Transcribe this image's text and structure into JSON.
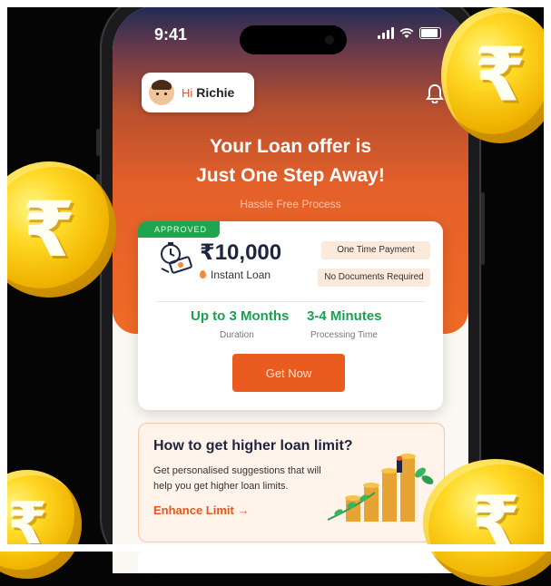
{
  "status_bar": {
    "time": "9:41"
  },
  "greeting": {
    "hi": "Hi",
    "name": "Richie"
  },
  "hero": {
    "title_line1": "Your Loan offer is",
    "title_line2": "Just One Step Away!",
    "subtitle": "Hassle Free Process"
  },
  "offer_card": {
    "badge": "APPROVED",
    "amount": "₹10,000",
    "amount_label": "Instant Loan",
    "chip1": "One Time Payment",
    "chip2": "No Documents Required",
    "duration_value": "Up to 3 Months",
    "duration_label": "Duration",
    "processing_value": "3-4 Minutes",
    "processing_label": "Processing Time",
    "cta": "Get Now"
  },
  "promo": {
    "title": "How to get higher loan limit?",
    "description": "Get personalised suggestions that will help you get higher loan limits.",
    "link": "Enhance Limit →"
  },
  "coin_symbol": "₹",
  "colors": {
    "accent_orange": "#ea5b1f",
    "success_green": "#19a24d",
    "navy_text": "#1d2540",
    "coin_gold": "#f0b400"
  },
  "icons": [
    "cellular-signal-icon",
    "wifi-icon",
    "battery-icon",
    "bell-icon",
    "money-stopwatch-icon",
    "growth-chart-illustration",
    "rupee-coin"
  ]
}
